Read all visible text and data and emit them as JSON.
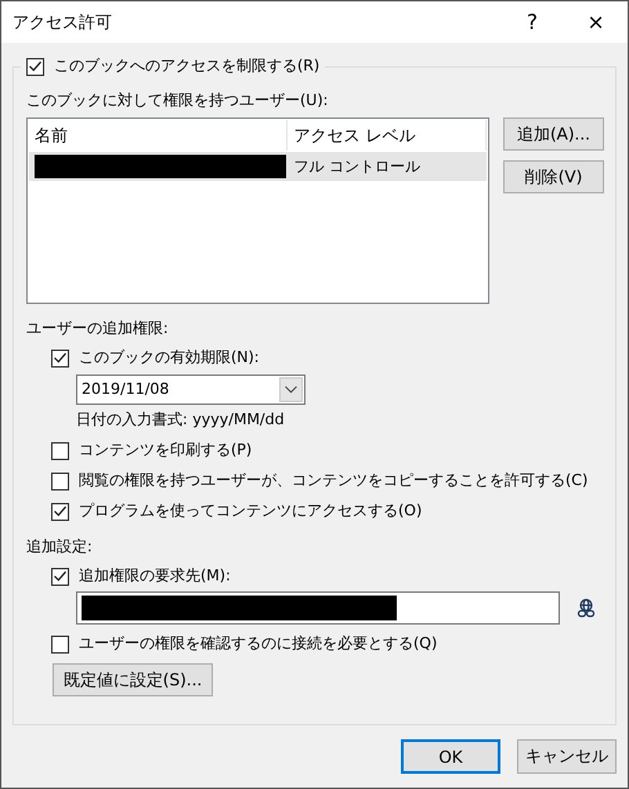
{
  "window": {
    "title": "アクセス許可",
    "help": "?",
    "close": "×"
  },
  "restrict": {
    "label": "このブックへのアクセスを制限する(R)",
    "checked": true
  },
  "users": {
    "label": "このブックに対して権限を持つユーザー(U):",
    "columns": [
      "名前",
      "アクセス レベル"
    ],
    "rows": [
      {
        "redacted": true,
        "access": "フル コントロール",
        "selected": true
      }
    ],
    "buttons": [
      "追加(A)...",
      "削除(V)"
    ]
  },
  "additional_permissions": {
    "label": "ユーザーの追加権限:",
    "expiry": {
      "label": "このブックの有効期限(N):",
      "checked": true,
      "date": "2019/11/08",
      "format_hint": "日付の入力書式: yyyy/MM/dd"
    },
    "options": [
      {
        "label": "コンテンツを印刷する(P)",
        "checked": false
      },
      {
        "label": "閲覧の権限を持つユーザーが、コンテンツをコピーすることを許可する(C)",
        "checked": false
      },
      {
        "label": "プログラムを使ってコンテンツにアクセスする(O)",
        "checked": true
      }
    ]
  },
  "additional_settings": {
    "label": "追加設定:",
    "request": {
      "label": "追加権限の要求先(M):",
      "checked": true,
      "redacted": true
    },
    "require_connection": {
      "label": "ユーザーの権限を確認するのに接続を必要とする(Q)",
      "checked": false
    },
    "default_button": "既定値に設定(S)..."
  },
  "footer": {
    "buttons": [
      {
        "label": "OK",
        "default": true
      },
      {
        "label": "キャンセル",
        "default": false
      }
    ]
  }
}
